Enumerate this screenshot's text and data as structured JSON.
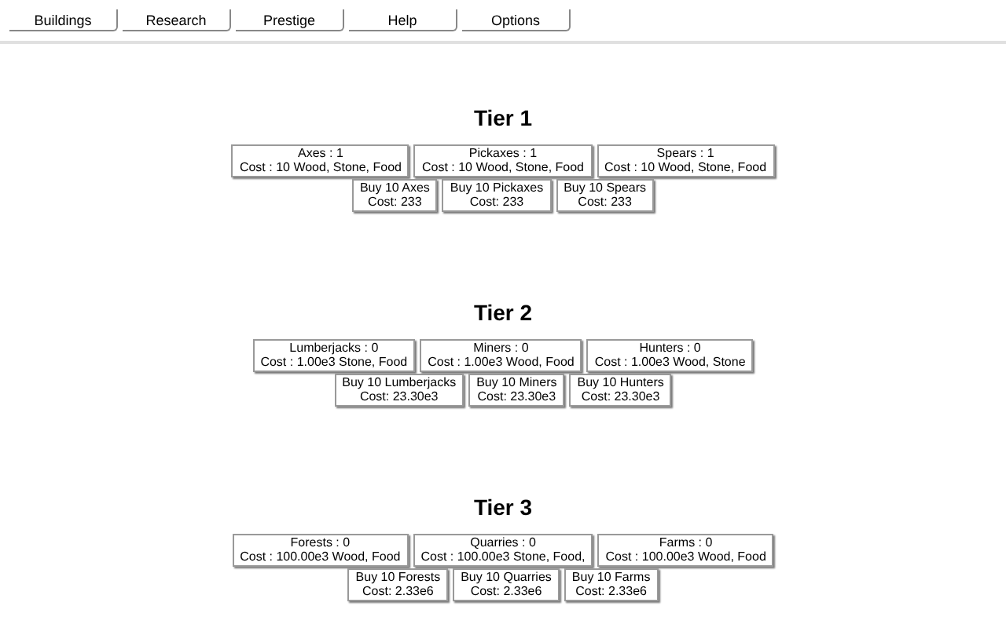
{
  "nav_tabs": [
    {
      "label": "Buildings"
    },
    {
      "label": "Research"
    },
    {
      "label": "Prestige"
    },
    {
      "label": "Help"
    },
    {
      "label": "Options"
    }
  ],
  "tiers": [
    {
      "title": "Tier 1",
      "buildings": [
        {
          "label": "Axes : 1",
          "cost": "Cost : 10 Wood, Stone, Food"
        },
        {
          "label": "Pickaxes : 1",
          "cost": "Cost : 10 Wood, Stone, Food"
        },
        {
          "label": "Spears : 1",
          "cost": "Cost : 10 Wood, Stone, Food"
        }
      ],
      "buy_buttons": [
        {
          "label": "Buy 10 Axes",
          "cost": "Cost: 233"
        },
        {
          "label": "Buy 10 Pickaxes",
          "cost": "Cost: 233"
        },
        {
          "label": "Buy 10 Spears",
          "cost": "Cost: 233"
        }
      ]
    },
    {
      "title": "Tier 2",
      "buildings": [
        {
          "label": "Lumberjacks : 0",
          "cost": "Cost : 1.00e3 Stone, Food"
        },
        {
          "label": "Miners : 0",
          "cost": "Cost : 1.00e3 Wood, Food"
        },
        {
          "label": "Hunters : 0",
          "cost": "Cost : 1.00e3 Wood, Stone"
        }
      ],
      "buy_buttons": [
        {
          "label": "Buy 10 Lumberjacks",
          "cost": "Cost: 23.30e3"
        },
        {
          "label": "Buy 10 Miners",
          "cost": "Cost: 23.30e3"
        },
        {
          "label": "Buy 10 Hunters",
          "cost": "Cost: 23.30e3"
        }
      ]
    },
    {
      "title": "Tier 3",
      "buildings": [
        {
          "label": "Forests : 0",
          "cost": "Cost : 100.00e3 Wood, Food"
        },
        {
          "label": "Quarries : 0",
          "cost": "Cost : 100.00e3 Stone, Food,"
        },
        {
          "label": "Farms : 0",
          "cost": "Cost : 100.00e3 Wood, Food"
        }
      ],
      "buy_buttons": [
        {
          "label": "Buy 10 Forests",
          "cost": "Cost: 2.33e6"
        },
        {
          "label": "Buy 10 Quarries",
          "cost": "Cost: 2.33e6"
        },
        {
          "label": "Buy 10 Farms",
          "cost": "Cost: 2.33e6"
        }
      ]
    }
  ]
}
